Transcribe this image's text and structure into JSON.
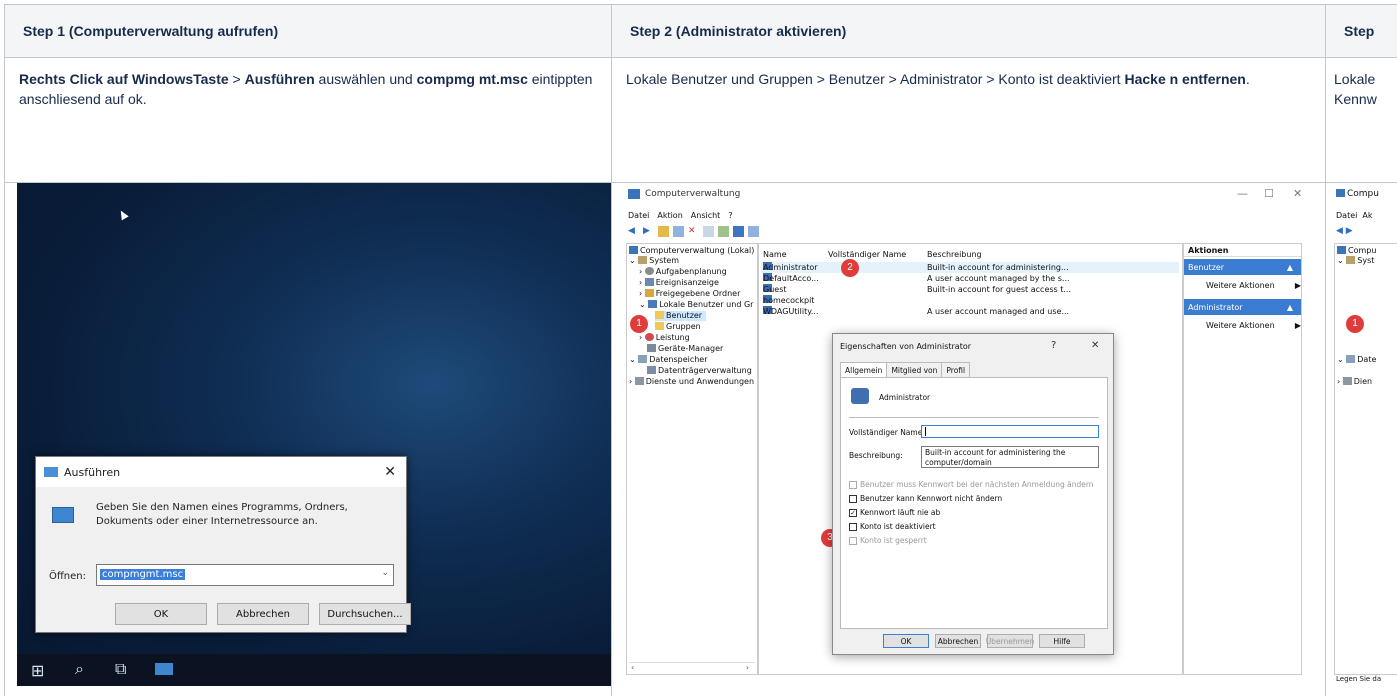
{
  "table": {
    "headers": [
      "Step 1  (Computerverwaltung aufrufen)",
      "Step 2 (Administrator aktivieren)",
      "Step"
    ],
    "step1": {
      "b1": "Rechts Click auf WindowsTaste",
      "t1": " > ",
      "b2": "Ausführen",
      "t2": " auswählen und ",
      "b3": "compmg mt.msc",
      "t3": " eintippten anschliesend auf ok."
    },
    "step2": {
      "t1": "Lokale Benutzer und Gruppen > Benutzer > Administrator > Konto ist deaktiviert ",
      "b1": "Hacke n entfernen",
      "t2": "."
    },
    "step3": {
      "l1": "Lokale",
      "l2": "Kennw"
    }
  },
  "run_dialog": {
    "title": "Ausführen",
    "description": "Geben Sie den Namen eines Programms, Ordners, Dokuments oder einer Internetressource an.",
    "open_label": "Öffnen:",
    "open_value": "compmgmt.msc",
    "buttons": [
      "OK",
      "Abbrechen",
      "Durchsuchen..."
    ]
  },
  "computer_mgmt": {
    "title": "Computerverwaltung",
    "menu": [
      "Datei",
      "Aktion",
      "Ansicht",
      "?"
    ],
    "tree": [
      "Computerverwaltung (Lokal)",
      "System",
      "Aufgabenplanung",
      "Ereignisanzeige",
      "Freigegebene Ordner",
      "Lokale Benutzer und Gr",
      "Benutzer",
      "Gruppen",
      "Leistung",
      "Geräte-Manager",
      "Datenspeicher",
      "Datenträgerverwaltung",
      "Dienste und Anwendungen"
    ],
    "columns": [
      "Name",
      "Vollständiger Name",
      "Beschreibung"
    ],
    "rows": [
      {
        "name": "Administrator",
        "desc": "Built-in account for administering..."
      },
      {
        "name": "DefaultAcco...",
        "desc": "A user account managed by the s..."
      },
      {
        "name": "Guest",
        "desc": "Built-in account for guest access t..."
      },
      {
        "name": "homecockpit",
        "desc": ""
      },
      {
        "name": "WDAGUtility...",
        "desc": "A user account managed and use..."
      }
    ],
    "actions": {
      "header": "Aktionen",
      "section1": "Benutzer",
      "section2": "Administrator",
      "more": "Weitere Aktionen"
    },
    "badges": [
      "1",
      "2",
      "3"
    ]
  },
  "props_dialog": {
    "title": "Eigenschaften von Administrator",
    "help": "?",
    "tabs": [
      "Allgemein",
      "Mitglied von",
      "Profil"
    ],
    "user": "Administrator",
    "fullname_label": "Vollständiger Name:",
    "desc_label": "Beschreibung:",
    "desc_value": "Built-in account for administering the computer/domain",
    "checks": [
      {
        "label": "Benutzer muss Kennwort bei der nächsten Anmeldung ändern",
        "checked": false,
        "disabled": true
      },
      {
        "label": "Benutzer kann Kennwort nicht ändern",
        "checked": false,
        "disabled": false
      },
      {
        "label": "Kennwort läuft nie ab",
        "checked": true,
        "disabled": false
      },
      {
        "label": "Konto ist deaktiviert",
        "checked": false,
        "disabled": false
      },
      {
        "label": "Konto ist gesperrt",
        "checked": false,
        "disabled": true
      }
    ],
    "buttons": [
      "OK",
      "Abbrechen",
      "Übernehmen",
      "Hilfe"
    ]
  },
  "cm3": {
    "title": "Compu",
    "menu": "Datei  Ak",
    "tree": [
      "Compu",
      "Syst",
      "Date",
      "Dien"
    ],
    "status": "Legen Sie da"
  }
}
